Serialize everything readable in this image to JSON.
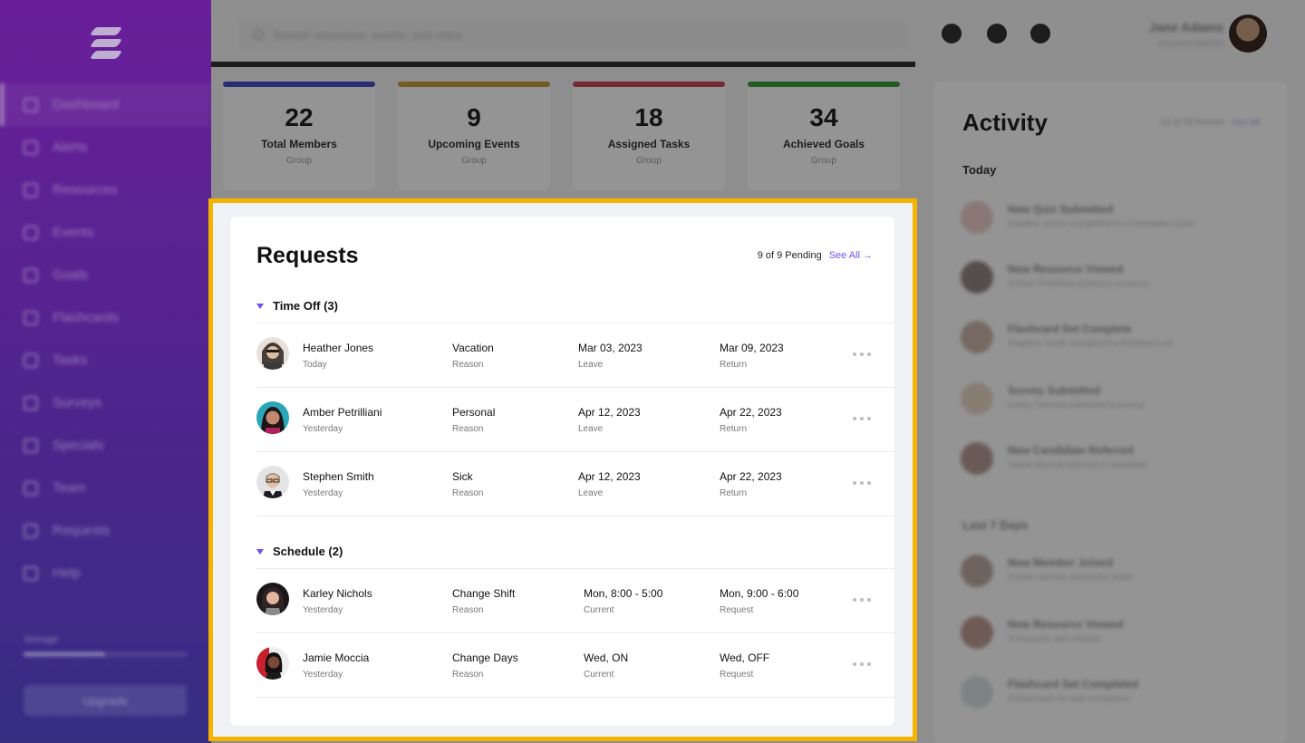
{
  "sidebar": {
    "nav": [
      "Dashboard",
      "Alerts",
      "Resources",
      "Events",
      "Goals",
      "Flashcards",
      "Tasks",
      "Surveys",
      "Specials",
      "Team",
      "Requests",
      "Help"
    ],
    "storage_label": "Storage",
    "upgrade_label": "Upgrade"
  },
  "topbar": {
    "search_placeholder": "Search resources, events, and more",
    "user_name": "Jane Adams",
    "user_role": "Account Admin"
  },
  "stats": [
    {
      "value": "22",
      "label": "Total Members",
      "sub": "Group",
      "color": "#4b4fc7"
    },
    {
      "value": "9",
      "label": "Upcoming Events",
      "sub": "Group",
      "color": "#c6a23a"
    },
    {
      "value": "18",
      "label": "Assigned Tasks",
      "sub": "Group",
      "color": "#c84a5a"
    },
    {
      "value": "34",
      "label": "Achieved Goals",
      "sub": "Group",
      "color": "#3f9a3d"
    }
  ],
  "activity": {
    "title": "Activity",
    "meta": "16 of 28 Recent",
    "see_all": "See All",
    "today": "Today",
    "last7": "Last 7 Days",
    "items_today": [
      {
        "title": "New Quiz Submitted",
        "desc": "Heather Jones completed the Orientation Quiz"
      },
      {
        "title": "New Resource Viewed",
        "desc": "Amber Petrilliani viewed a resource"
      },
      {
        "title": "Flashcard Set Complete",
        "desc": "Stephen Smith completed a flashcard set"
      },
      {
        "title": "Survey Submitted",
        "desc": "Karley Nichols submitted a survey"
      },
      {
        "title": "New Candidate Referred",
        "desc": "Jamie Moccia referred a candidate"
      }
    ],
    "items_week": [
      {
        "title": "New Member Joined",
        "desc": "A new member joined the team"
      },
      {
        "title": "New Resource Viewed",
        "desc": "A resource was viewed"
      },
      {
        "title": "Flashcard Set Completed",
        "desc": "A flashcard set was completed"
      }
    ]
  },
  "requests": {
    "title": "Requests",
    "pending": "9 of 9 Pending",
    "see_all": "See All →",
    "time_off": {
      "header": "Time Off (3)",
      "rows": [
        {
          "name": "Heather Jones",
          "when": "Today",
          "reason": "Vacation",
          "reason_label": "Reason",
          "leave": "Mar 03, 2023",
          "leave_label": "Leave",
          "ret": "Mar 09, 2023",
          "ret_label": "Return"
        },
        {
          "name": "Amber Petrilliani",
          "when": "Yesterday",
          "reason": "Personal",
          "reason_label": "Reason",
          "leave": "Apr 12, 2023",
          "leave_label": "Leave",
          "ret": "Apr 22, 2023",
          "ret_label": "Return"
        },
        {
          "name": "Stephen Smith",
          "when": "Yesterday",
          "reason": "Sick",
          "reason_label": "Reason",
          "leave": "Apr 12, 2023",
          "leave_label": "Leave",
          "ret": "Apr 22, 2023",
          "ret_label": "Return"
        }
      ]
    },
    "schedule": {
      "header": "Schedule (2)",
      "rows": [
        {
          "name": "Karley Nichols",
          "when": "Yesterday",
          "reason": "Change Shift",
          "reason_label": "Reason",
          "current": "Mon, 8:00 - 5:00",
          "current_label": "Current",
          "request": "Mon, 9:00 - 6:00",
          "request_label": "Request"
        },
        {
          "name": "Jamie Moccia",
          "when": "Yesterday",
          "reason": "Change Days",
          "reason_label": "Reason",
          "current": "Wed, ON",
          "current_label": "Current",
          "request": "Wed, OFF",
          "request_label": "Request"
        }
      ]
    }
  },
  "colors": {
    "accent": "#6d4ff0",
    "highlight": "#f6b400"
  }
}
